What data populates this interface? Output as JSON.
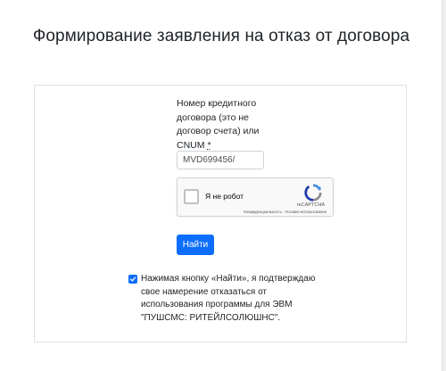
{
  "page": {
    "title": "Формирование заявления на отказ от договора"
  },
  "form": {
    "field_label": "Номер кредитного договора (это не договор счета) или CNUM",
    "required_mark": "*",
    "contract_input_value": "MVD699456/",
    "submit_label": "Найти",
    "consent_checked": true,
    "consent_text": "Нажимая кнопку «Найти», я подтверждаю свое намерение отказаться от использования программы для ЭВМ \"ПУШСМС: РИТЕЙЛСОЛЮШНС\"."
  },
  "recaptcha": {
    "label": "Я не робот",
    "brand": "reCAPTCHA",
    "links": "Конфиденциальность - Условия использования"
  },
  "colors": {
    "primary": "#0d6efd",
    "text": "#212529",
    "border": "#e1e1e1"
  },
  "icons": {
    "recaptcha_logo": "recaptcha-logo-icon",
    "checkmark": "checkmark-icon"
  }
}
